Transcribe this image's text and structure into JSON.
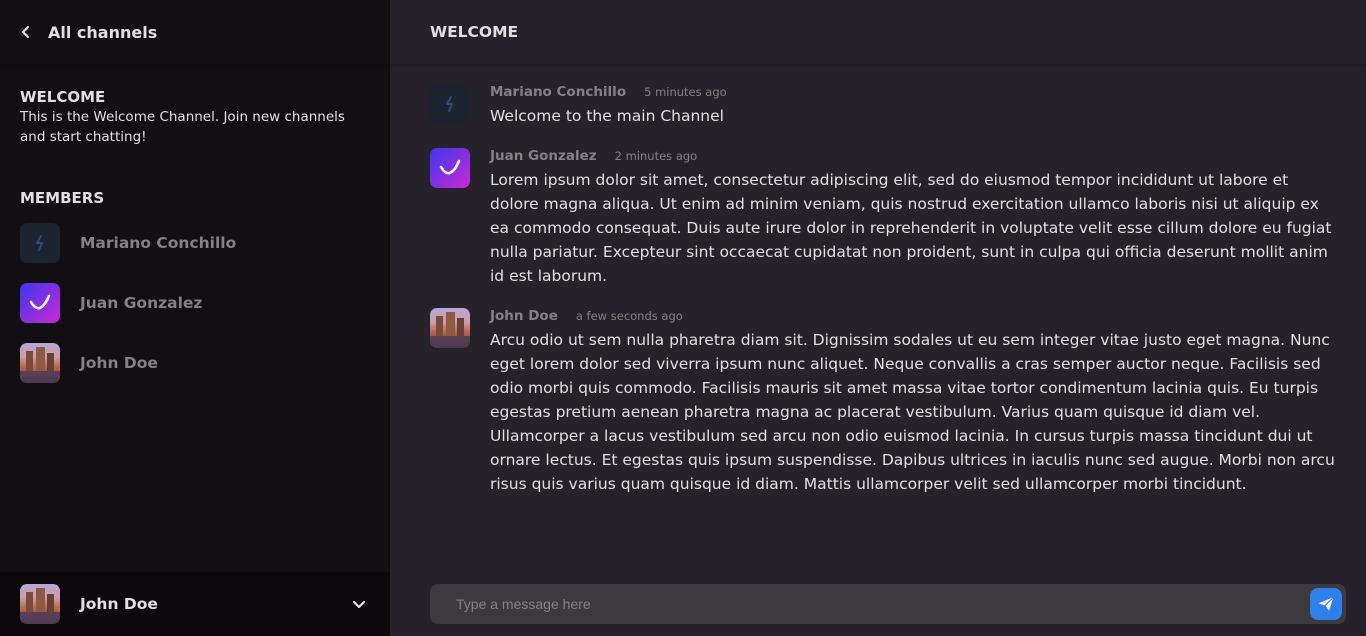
{
  "sidebar": {
    "back_label": "All channels",
    "channel": {
      "name": "WELCOME",
      "description": "This is the Welcome Channel. Join new channels and start chatting!"
    },
    "members_title": "MEMBERS",
    "members": [
      {
        "name": "Mariano Conchillo",
        "avatar": "dark-logo-avatar"
      },
      {
        "name": "Juan Gonzalez",
        "avatar": "gradient-check-avatar"
      },
      {
        "name": "John Doe",
        "avatar": "photo-avatar"
      }
    ],
    "current_user": {
      "name": "John Doe"
    }
  },
  "main": {
    "channel_title": "WELCOME",
    "messages": [
      {
        "author": "Mariano Conchillo",
        "time": "5 minutes ago",
        "text": "Welcome to the main Channel"
      },
      {
        "author": "Juan Gonzalez",
        "time": "2 minutes ago",
        "text": "Lorem ipsum dolor sit amet, consectetur adipiscing elit, sed do eiusmod tempor incididunt ut labore et dolore magna aliqua. Ut enim ad minim veniam, quis nostrud exercitation ullamco laboris nisi ut aliquip ex ea commodo consequat. Duis aute irure dolor in reprehenderit in voluptate velit esse cillum dolore eu fugiat nulla pariatur. Excepteur sint occaecat cupidatat non proident, sunt in culpa qui officia deserunt mollit anim id est laborum."
      },
      {
        "author": "John Doe",
        "time": "a few seconds ago",
        "text": "Arcu odio ut sem nulla pharetra diam sit. Dignissim sodales ut eu sem integer vitae justo eget magna. Nunc eget lorem dolor sed viverra ipsum nunc aliquet. Neque convallis a cras semper auctor neque. Facilisis sed odio morbi quis commodo. Facilisis mauris sit amet massa vitae tortor condimentum lacinia quis. Eu turpis egestas pretium aenean pharetra magna ac placerat vestibulum. Varius quam quisque id diam vel. Ullamcorper a lacus vestibulum sed arcu non odio euismod lacinia. In cursus turpis massa tincidunt dui ut ornare lectus. Et egestas quis ipsum suspendisse. Dapibus ultrices in iaculis nunc sed augue. Morbi non arcu risus quis varius quam quisque id diam. Mattis ullamcorper velit sed ullamcorper morbi tincidunt."
      }
    ],
    "composer": {
      "placeholder": "Type a message here",
      "value": ""
    }
  },
  "colors": {
    "sidebar_bg": "#120f13",
    "main_bg": "#252329",
    "footer_bg": "#0b090c",
    "input_bg": "#3c393f",
    "accent": "#2f80ed",
    "muted_text": "#828282",
    "text": "#e0e0e0"
  },
  "icons": {
    "back": "chevron-left-icon",
    "user_menu": "chevron-down-icon",
    "send": "send-icon"
  }
}
